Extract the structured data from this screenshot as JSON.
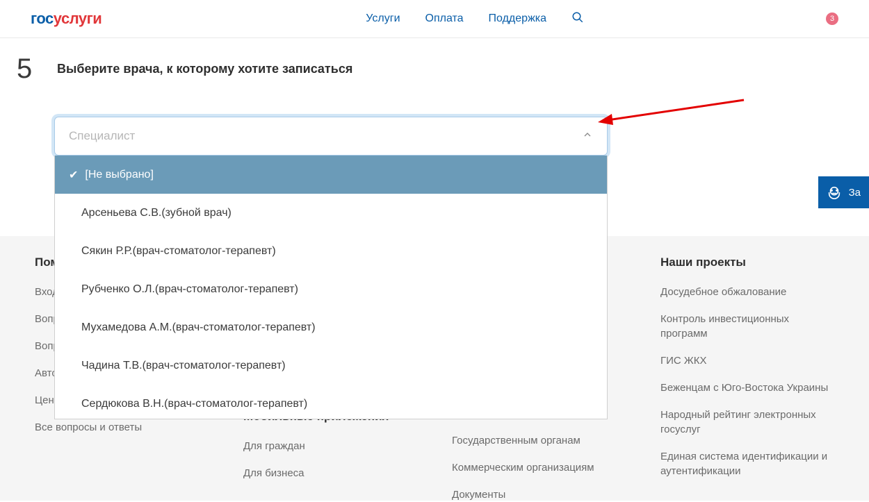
{
  "header": {
    "logo_gos": "гос",
    "logo_uslugi": "услуги",
    "nav": {
      "services": "Услуги",
      "payment": "Оплата",
      "support": "Поддержка"
    },
    "badge": "3"
  },
  "step": {
    "number": "5",
    "title": "Выберите врача, к которому хотите записаться"
  },
  "dropdown": {
    "placeholder": "Специалист",
    "selected": "[Не выбрано]",
    "options": [
      "Арсеньева С.В.(зубной врач)",
      "Сякин Р.Р.(врач-стоматолог-терапевт)",
      "Рубченко О.Л.(врач-стоматолог-терапевт)",
      "Мухамедова А.М.(врач-стоматолог-терапевт)",
      "Чадина Т.В.(врач-стоматолог-терапевт)",
      "Сердюкова В.Н.(врач-стоматолог-терапевт)"
    ]
  },
  "ask_tab": "За",
  "footer": {
    "help": {
      "heading": "Пом",
      "items": [
        "Вход",
        "Вопр",
        "Вопр",
        "Авто",
        "Цент",
        "Все вопросы и ответы"
      ]
    },
    "mobile": {
      "heading": "Мобильные приложения",
      "items": [
        "Для граждан",
        "Для бизнеса"
      ]
    },
    "partners": {
      "items": [
        "Государственным органам",
        "Коммерческим организациям",
        "Документы"
      ]
    },
    "projects": {
      "heading": "Наши проекты",
      "items": [
        "Досудебное обжалование",
        "Контроль инвестиционных программ",
        "ГИС ЖКХ",
        "Беженцам с Юго-Востока Украины",
        "Народный рейтинг электронных госуслуг",
        "Единая система идентификации и аутентификации"
      ]
    }
  }
}
